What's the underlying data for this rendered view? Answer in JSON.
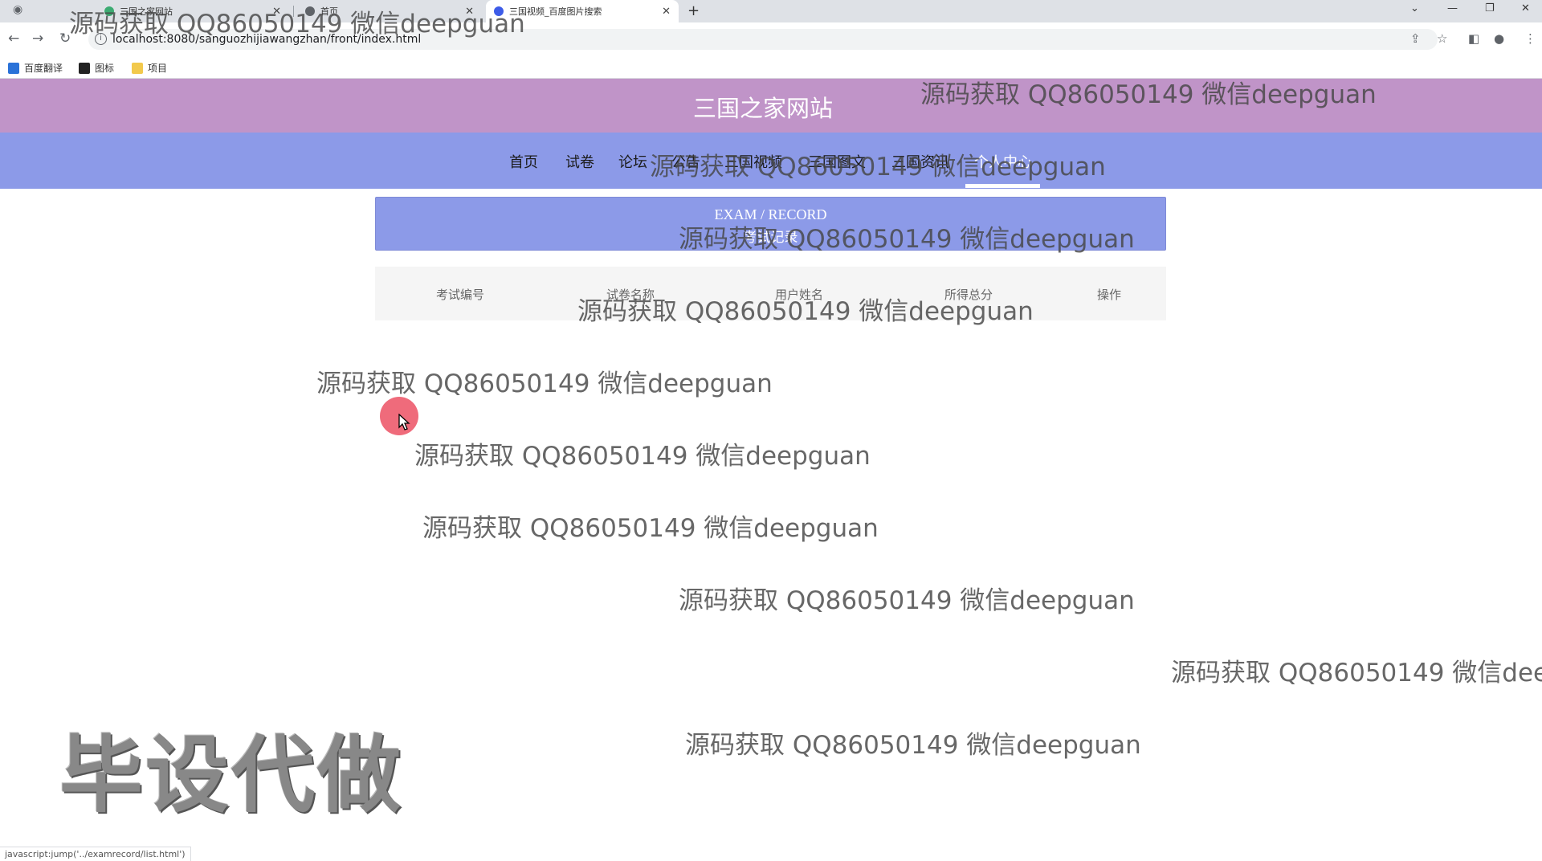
{
  "browser": {
    "tabs": [
      {
        "title": "三国之家网站",
        "active": false
      },
      {
        "title": "首页",
        "active": false
      },
      {
        "title": "三国视频_百度图片搜索",
        "active": true
      }
    ],
    "url": "localhost:8080/sanguozhijiawangzhan/front/index.html",
    "bookmarks": [
      "百度翻译",
      "图标",
      "项目"
    ],
    "status_url": "javascript:jump('../examrecord/list.html')"
  },
  "site": {
    "title": "三国之家网站",
    "nav": [
      "首页",
      "试卷",
      "论坛",
      "公告",
      "三国视频",
      "三国图文",
      "三国资讯",
      "个人中心"
    ],
    "active_nav": "个人中心"
  },
  "banner": {
    "en": "EXAM / RECORD",
    "zh": "考试记录"
  },
  "table": {
    "headers": [
      "考试编号",
      "试卷名称",
      "用户姓名",
      "所得总分",
      "操作"
    ],
    "rows": []
  },
  "watermark": {
    "text": "源码获取 QQ86050149 微信deepguan",
    "text_cut": "源码获取 QQ86050149 微信deep",
    "big": "毕设代做"
  },
  "colors": {
    "header": "#c094c8",
    "nav": "#8c9ae8",
    "banner": "#8c9ae8"
  }
}
